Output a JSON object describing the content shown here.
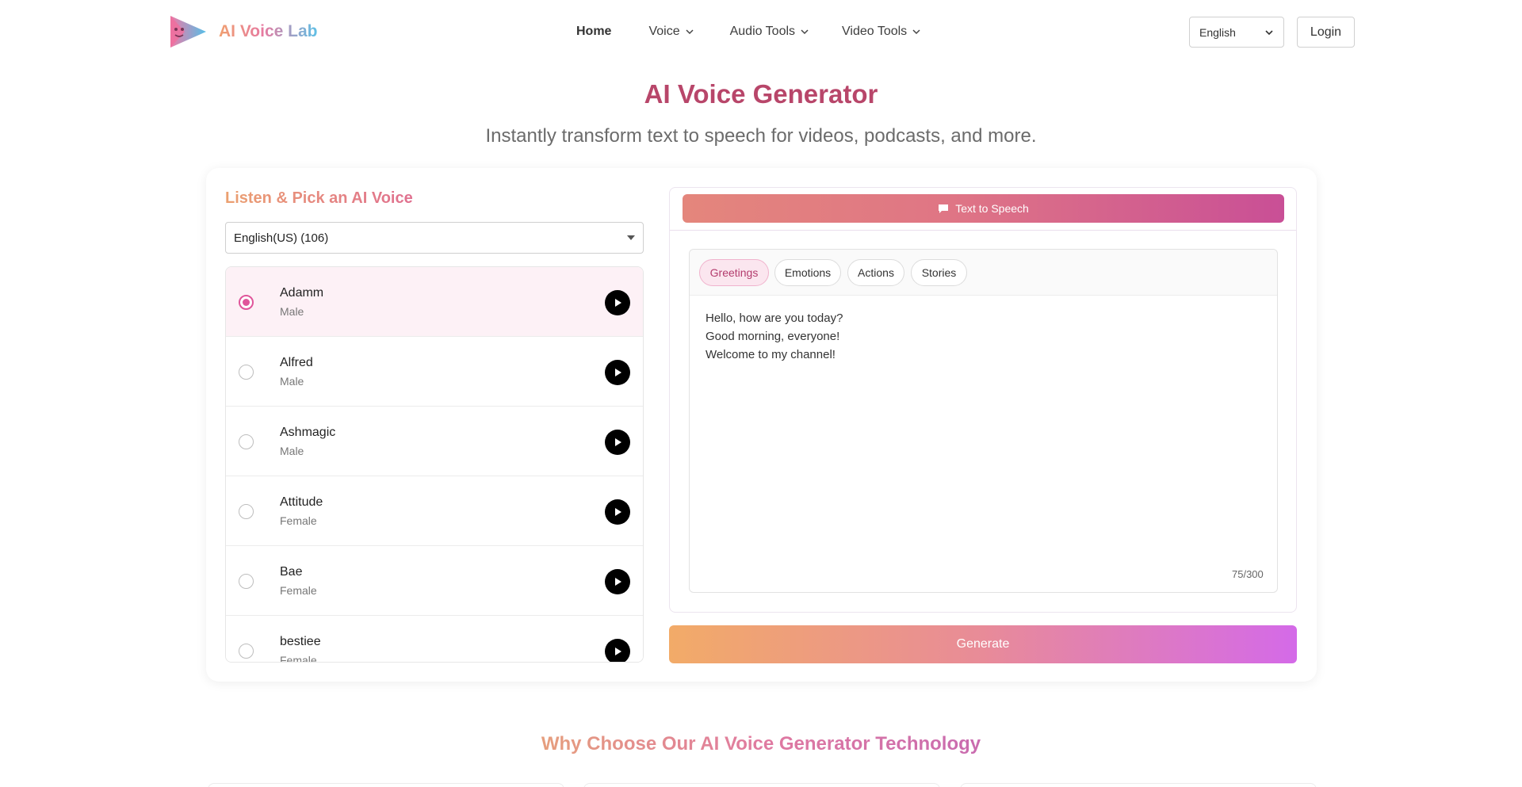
{
  "header": {
    "logo_text": "AI Voice Lab",
    "nav": [
      {
        "label": "Home",
        "active": true,
        "has_dropdown": false
      },
      {
        "label": "Voice",
        "active": false,
        "has_dropdown": true
      },
      {
        "label": "Audio Tools",
        "active": false,
        "has_dropdown": true
      },
      {
        "label": "Video Tools",
        "active": false,
        "has_dropdown": true
      }
    ],
    "language": "English",
    "login_label": "Login"
  },
  "hero": {
    "title": "AI Voice Generator",
    "subtitle": "Instantly transform text to speech for videos, podcasts, and more."
  },
  "voice_picker": {
    "title": "Listen & Pick an AI Voice",
    "language_filter": "English(US) (106)",
    "voices": [
      {
        "name": "Adamm",
        "gender": "Male",
        "selected": true
      },
      {
        "name": "Alfred",
        "gender": "Male",
        "selected": false
      },
      {
        "name": "Ashmagic",
        "gender": "Male",
        "selected": false
      },
      {
        "name": "Attitude",
        "gender": "Female",
        "selected": false
      },
      {
        "name": "Bae",
        "gender": "Female",
        "selected": false
      },
      {
        "name": "bestiee",
        "gender": "Female",
        "selected": false
      }
    ]
  },
  "editor": {
    "mode_label": "Text to Speech",
    "chips": [
      {
        "label": "Greetings",
        "active": true
      },
      {
        "label": "Emotions",
        "active": false
      },
      {
        "label": "Actions",
        "active": false
      },
      {
        "label": "Stories",
        "active": false
      }
    ],
    "text_lines": [
      "Hello, how are you today?",
      "Good morning, everyone!",
      "Welcome to my channel!"
    ],
    "char_count": "75/300",
    "generate_label": "Generate"
  },
  "section": {
    "why_title": "Why Choose Our AI Voice Generator Technology"
  },
  "colors": {
    "title_accent": "#b8466a",
    "selected_radio": "#e0559a",
    "generate_start": "#f2ab68",
    "generate_end": "#d46ae8"
  }
}
